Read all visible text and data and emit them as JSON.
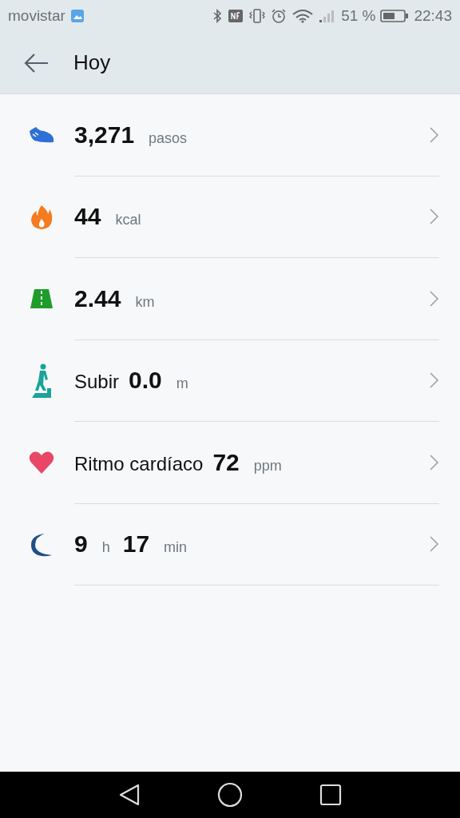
{
  "status_bar": {
    "carrier": "movistar",
    "battery": "51 %",
    "time": "22:43"
  },
  "header": {
    "title": "Hoy"
  },
  "rows": [
    {
      "kind": "steps",
      "parts": [
        {
          "kind": "value",
          "text": "3,271"
        },
        {
          "kind": "unit",
          "text": "pasos"
        }
      ]
    },
    {
      "kind": "calories",
      "parts": [
        {
          "kind": "value",
          "text": "44"
        },
        {
          "kind": "unit",
          "text": "kcal"
        }
      ]
    },
    {
      "kind": "distance",
      "parts": [
        {
          "kind": "value",
          "text": "2.44"
        },
        {
          "kind": "unit",
          "text": "km"
        }
      ]
    },
    {
      "kind": "climb",
      "parts": [
        {
          "kind": "label",
          "text": "Subir"
        },
        {
          "kind": "value",
          "text": "0.0"
        },
        {
          "kind": "unit",
          "text": "m"
        }
      ]
    },
    {
      "kind": "heart",
      "parts": [
        {
          "kind": "label",
          "text": "Ritmo cardíaco"
        },
        {
          "kind": "value",
          "text": "72"
        },
        {
          "kind": "unit",
          "text": "ppm"
        }
      ]
    },
    {
      "kind": "sleep",
      "parts": [
        {
          "kind": "value",
          "text": "9"
        },
        {
          "kind": "unit",
          "text": "h"
        },
        {
          "kind": "value",
          "text": "17"
        },
        {
          "kind": "unit",
          "text": "min"
        }
      ]
    }
  ]
}
